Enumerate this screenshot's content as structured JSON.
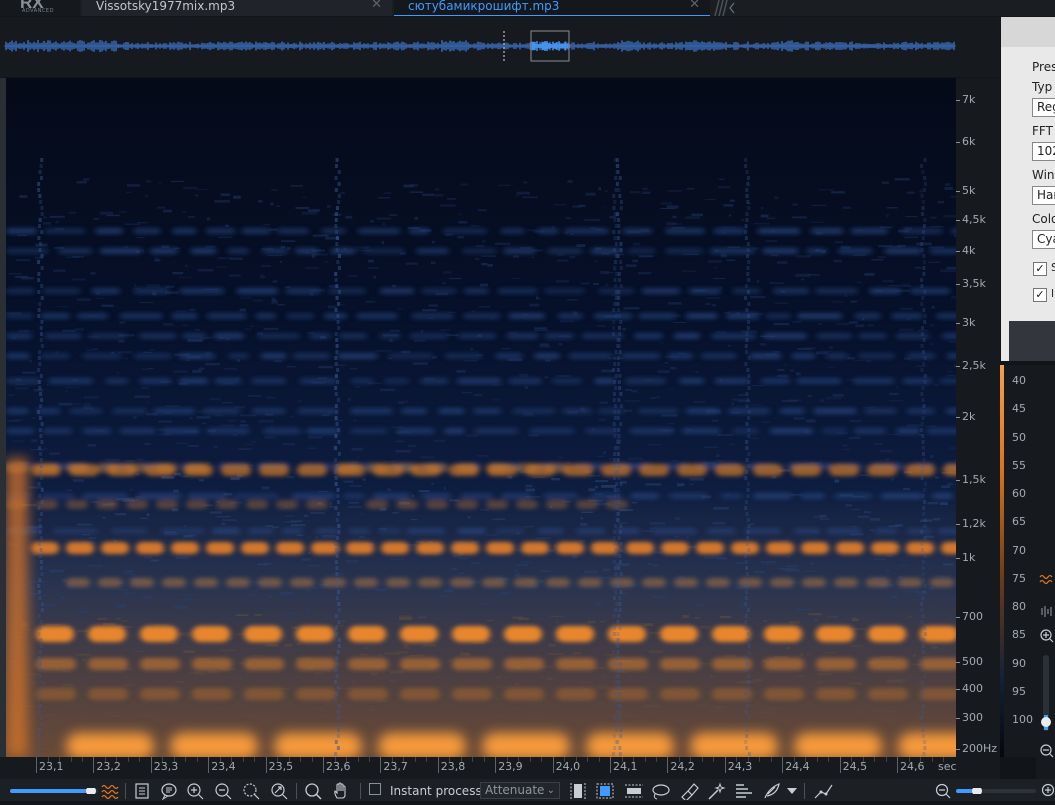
{
  "app": {
    "logo": "RX",
    "logo_sub": "ADVANCED"
  },
  "tabs": [
    {
      "label": "Vissotsky1977mix.mp3",
      "active": false
    },
    {
      "label": "сютубамикрошифт.mp3",
      "active": true
    }
  ],
  "tab_close": "✕",
  "freq_axis": {
    "labels": [
      "7k",
      "6k",
      "5k",
      "4,5k",
      "4k",
      "3,5k",
      "3k",
      "2,5k",
      "2k",
      "1,5k",
      "1,2k",
      "1k",
      "700",
      "500",
      "400",
      "300",
      "200Hz"
    ]
  },
  "db_axis": {
    "labels": [
      "40",
      "45",
      "50",
      "55",
      "60",
      "65",
      "70",
      "75",
      "80",
      "85",
      "90",
      "95",
      "100"
    ]
  },
  "time_axis": {
    "labels": [
      "23,1",
      "23,2",
      "23,3",
      "23,4",
      "23,5",
      "23,6",
      "23,7",
      "23,8",
      "23,9",
      "24,0",
      "24,1",
      "24,2",
      "24,3",
      "24,4",
      "24,5",
      "24,6"
    ],
    "unit": "sec"
  },
  "settings_popup": {
    "labels": [
      "Pres",
      "Typ",
      "FFT",
      "Win",
      "Colo"
    ],
    "selects": [
      "Reg",
      "102",
      "Har",
      "Cya"
    ],
    "checks": [
      {
        "checked": true,
        "mark": "✓",
        "label": "S"
      },
      {
        "checked": true,
        "mark": "✓",
        "label": "l"
      }
    ]
  },
  "toolbar": {
    "instant_process": "Instant process",
    "mode": "Attenuate",
    "instant_checked": false
  },
  "colors": {
    "accent": "#3f9bff",
    "spectrum_hot": "#f39a3c",
    "spectrum_cold": "#0a1430"
  }
}
